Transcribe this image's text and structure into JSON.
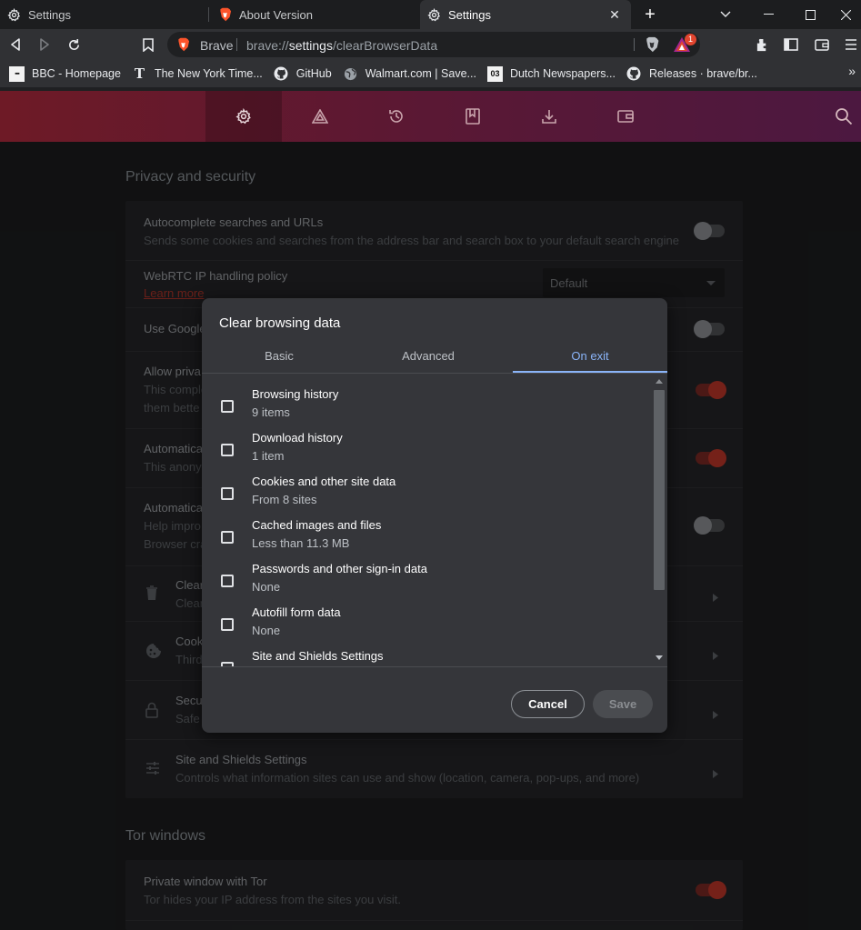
{
  "tabs": [
    {
      "title": "Settings",
      "icon": "gear-icon",
      "active": false
    },
    {
      "title": "About Version",
      "icon": "brave-lion-icon",
      "active": false
    },
    {
      "title": "Settings",
      "icon": "gear-icon",
      "active": true
    }
  ],
  "toolbar": {
    "omnibox_label": "Brave",
    "url_prefix": "brave://",
    "url_host": "settings",
    "url_path": "/clearBrowserData",
    "rewards_badge": "1"
  },
  "bookmarks": [
    {
      "label": "BBC - Homepage",
      "icon": "bbc-icon",
      "icon_text": "▪▪▪"
    },
    {
      "label": "The New York Time...",
      "icon": "nyt-icon",
      "icon_text": "T"
    },
    {
      "label": "GitHub",
      "icon": "github-icon",
      "icon_text": ""
    },
    {
      "label": "Walmart.com | Save...",
      "icon": "globe-icon",
      "icon_text": ""
    },
    {
      "label": "Dutch Newspapers...",
      "icon": "dutch-newspapers-icon",
      "icon_text": "03"
    },
    {
      "label": "Releases · brave/br...",
      "icon": "github-icon",
      "icon_text": ""
    }
  ],
  "bookmarks_more": "»",
  "settings_nav": [
    "gear-icon",
    "shields-icon",
    "history-icon",
    "bookmarks-icon",
    "downloads-icon",
    "wallet-icon"
  ],
  "privacy": {
    "section_title": "Privacy and security",
    "autocomplete_title": "Autocomplete searches and URLs",
    "autocomplete_sub": "Sends some cookies and searches from the address bar and search box to your default search engine",
    "webrtc_title": "WebRTC IP handling policy",
    "webrtc_link": "Learn more",
    "webrtc_value": "Default",
    "google_title": "Use Google",
    "allow_title": "Allow priva",
    "allow_sub1": "This comple",
    "allow_sub2": "them bette",
    "auto1_title": "Automatica",
    "auto1_sub": "This anonym",
    "auto2_title": "Automatica",
    "auto2_sub1": "Help impro",
    "auto2_sub2": "Browser cra",
    "clear_title": "Clear",
    "clear_sub": "Clear",
    "cookies_title": "Cook",
    "cookies_sub": "Third",
    "security_title": "Secu",
    "security_sub": "Safe",
    "site_title": "Site and Shields Settings",
    "site_sub": "Controls what information sites can use and show (location, camera, pop-ups, and more)"
  },
  "tor": {
    "section_title": "Tor windows",
    "private_title": "Private window with Tor",
    "private_sub": "Tor hides your IP address from the sites you visit."
  },
  "dialog": {
    "title": "Clear browsing data",
    "tabs": [
      "Basic",
      "Advanced",
      "On exit"
    ],
    "active_tab": "On exit",
    "items": [
      {
        "title": "Browsing history",
        "sub": "9 items",
        "checked": false
      },
      {
        "title": "Download history",
        "sub": "1 item",
        "checked": false
      },
      {
        "title": "Cookies and other site data",
        "sub": "From 8 sites",
        "checked": false
      },
      {
        "title": "Cached images and files",
        "sub": "Less than 11.3 MB",
        "checked": false
      },
      {
        "title": "Passwords and other sign-in data",
        "sub": "None",
        "checked": false
      },
      {
        "title": "Autofill form data",
        "sub": "None",
        "checked": false
      },
      {
        "title": "Site and Shields Settings",
        "sub": "",
        "checked": false
      }
    ],
    "cancel_label": "Cancel",
    "save_label": "Save"
  },
  "colors": {
    "accent_blue": "#8ab4f8",
    "brave_orange": "#fb542b",
    "toggle_on": "#d53d2e",
    "header_gradient_start": "#6e1a26",
    "header_gradient_end": "#4c1840"
  }
}
